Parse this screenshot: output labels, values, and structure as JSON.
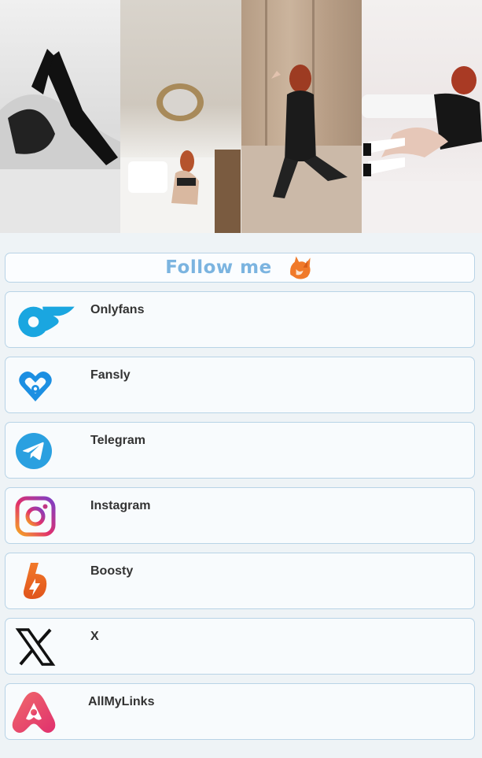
{
  "follow": {
    "label": "Follow me"
  },
  "links": [
    {
      "label": "Onlyfans",
      "icon": "onlyfans-icon"
    },
    {
      "label": "Fansly",
      "icon": "fansly-icon"
    },
    {
      "label": "Telegram",
      "icon": "telegram-icon"
    },
    {
      "label": "Instagram",
      "icon": "instagram-icon"
    },
    {
      "label": "Boosty",
      "icon": "boosty-icon"
    },
    {
      "label": "X",
      "icon": "x-icon"
    },
    {
      "label": "AllMyLinks",
      "icon": "allmylinks-icon"
    }
  ],
  "colors": {
    "accent": "#7bb4e0",
    "card_border": "#b8d3e6",
    "page_bg": "#eef3f6"
  }
}
